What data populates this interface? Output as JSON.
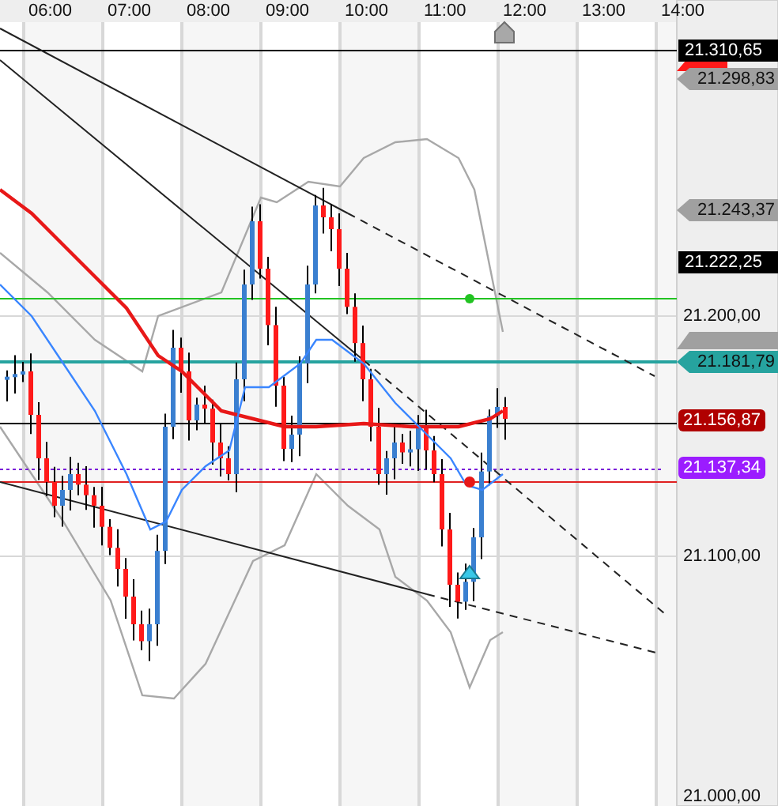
{
  "time_axis": {
    "labels": [
      "06:00",
      "07:00",
      "08:00",
      "09:00",
      "10:00",
      "11:00",
      "12:00",
      "13:00",
      "14:00"
    ]
  },
  "price_axis": {
    "labels": [
      {
        "text": "21.310,65",
        "kind": "line-label",
        "color": "#000000"
      },
      {
        "text": "21.298,83",
        "kind": "tag",
        "color": "#a0a0a0"
      },
      {
        "text": "21.243,37",
        "kind": "tag",
        "color": "#a0a0a0"
      },
      {
        "text": "21.222,25",
        "kind": "line-label",
        "color": "#000000"
      },
      {
        "text": "21.200,00",
        "kind": "tick"
      },
      {
        "text": "21.181,79",
        "kind": "tag",
        "color": "#26a39f"
      },
      {
        "text": "21.156,87",
        "kind": "badge",
        "color": "#b00000"
      },
      {
        "text": "21.137,34",
        "kind": "badge",
        "color": "#9b1cff"
      },
      {
        "text": "21.100,00",
        "kind": "tick"
      },
      {
        "text": "21.000,00",
        "kind": "tick"
      }
    ]
  }
}
